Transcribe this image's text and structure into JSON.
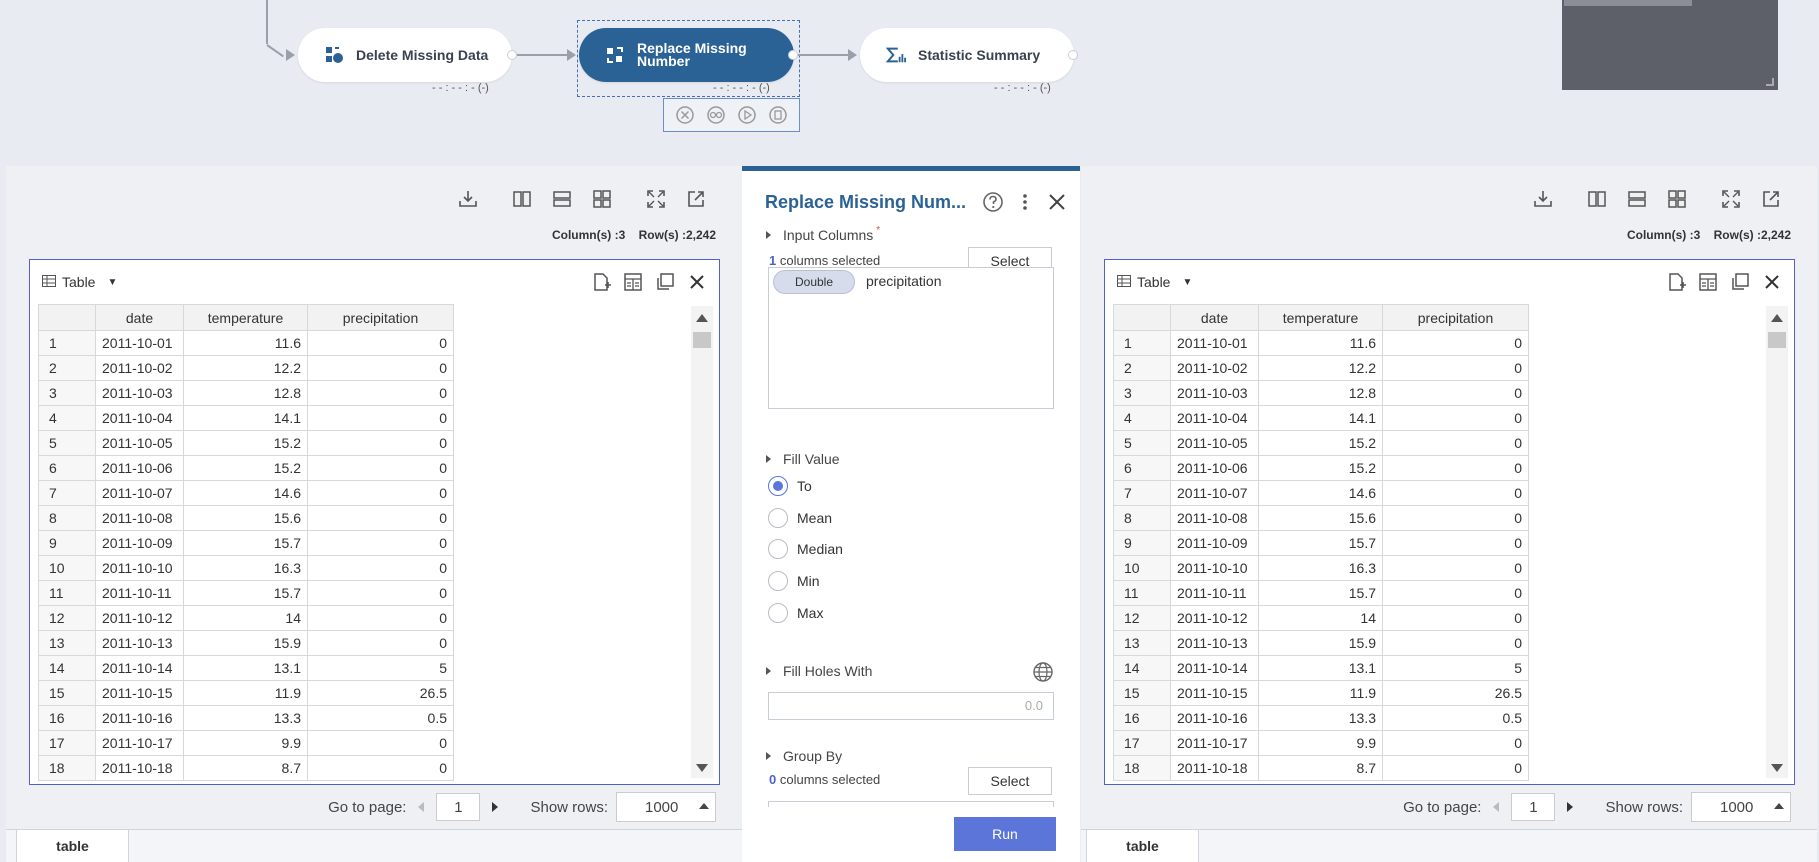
{
  "workflow": {
    "nodes": [
      {
        "label": "Delete Missing Data",
        "status": "- - : - - : - (-)",
        "icon": "delete-missing-icon"
      },
      {
        "label": "Replace Missing Number",
        "status": "- - : - - : - (-)",
        "icon": "replace-missing-icon"
      },
      {
        "label": "Statistic Summary",
        "status": "- - : - - : - (-)",
        "icon": "sigma-chart-icon"
      }
    ],
    "node_toolbar": [
      "close-circle-icon",
      "view-icon",
      "play-icon",
      "clipboard-icon"
    ]
  },
  "left_panel": {
    "counts": {
      "columns": "Column(s) :3",
      "rows": "Row(s) :2,242"
    },
    "table_label": "Table",
    "pager": {
      "goto_label": "Go to page:",
      "page": "1",
      "rows_label": "Show rows:",
      "rows_value": "1000"
    },
    "tab": "table"
  },
  "right_panel": {
    "counts": {
      "columns": "Column(s) :3",
      "rows": "Row(s) :2,242"
    },
    "table_label": "Table",
    "pager": {
      "goto_label": "Go to page:",
      "page": "1",
      "rows_label": "Show rows:",
      "rows_value": "1000"
    },
    "tab": "table"
  },
  "table": {
    "headers": [
      "",
      "date",
      "temperature",
      "precipitation"
    ],
    "rows": [
      [
        "1",
        "2011-10-01",
        "11.6",
        "0"
      ],
      [
        "2",
        "2011-10-02",
        "12.2",
        "0"
      ],
      [
        "3",
        "2011-10-03",
        "12.8",
        "0"
      ],
      [
        "4",
        "2011-10-04",
        "14.1",
        "0"
      ],
      [
        "5",
        "2011-10-05",
        "15.2",
        "0"
      ],
      [
        "6",
        "2011-10-06",
        "15.2",
        "0"
      ],
      [
        "7",
        "2011-10-07",
        "14.6",
        "0"
      ],
      [
        "8",
        "2011-10-08",
        "15.6",
        "0"
      ],
      [
        "9",
        "2011-10-09",
        "15.7",
        "0"
      ],
      [
        "10",
        "2011-10-10",
        "16.3",
        "0"
      ],
      [
        "11",
        "2011-10-11",
        "15.7",
        "0"
      ],
      [
        "12",
        "2011-10-12",
        "14",
        "0"
      ],
      [
        "13",
        "2011-10-13",
        "15.9",
        "0"
      ],
      [
        "14",
        "2011-10-14",
        "13.1",
        "5"
      ],
      [
        "15",
        "2011-10-15",
        "11.9",
        "26.5"
      ],
      [
        "16",
        "2011-10-16",
        "13.3",
        "0.5"
      ],
      [
        "17",
        "2011-10-17",
        "9.9",
        "0"
      ],
      [
        "18",
        "2011-10-18",
        "8.7",
        "0"
      ]
    ]
  },
  "config": {
    "title": "Replace Missing Num...",
    "input_columns": {
      "label": "Input Columns",
      "required": "*",
      "count": "1",
      "count_suffix": " columns selected",
      "select": "Select",
      "chip": "Double",
      "column": "precipitation"
    },
    "fill_value": {
      "label": "Fill Value",
      "options": [
        "To",
        "Mean",
        "Median",
        "Min",
        "Max"
      ],
      "selected": "To"
    },
    "fill_holes": {
      "label": "Fill Holes With",
      "value": "0.0"
    },
    "group_by": {
      "label": "Group By",
      "count": "0",
      "count_suffix": " columns selected",
      "select": "Select"
    },
    "run": "Run"
  },
  "colors": {
    "accent": "#2b6296",
    "primary_button": "#5b75d9",
    "table_border": "#4e63c9"
  }
}
